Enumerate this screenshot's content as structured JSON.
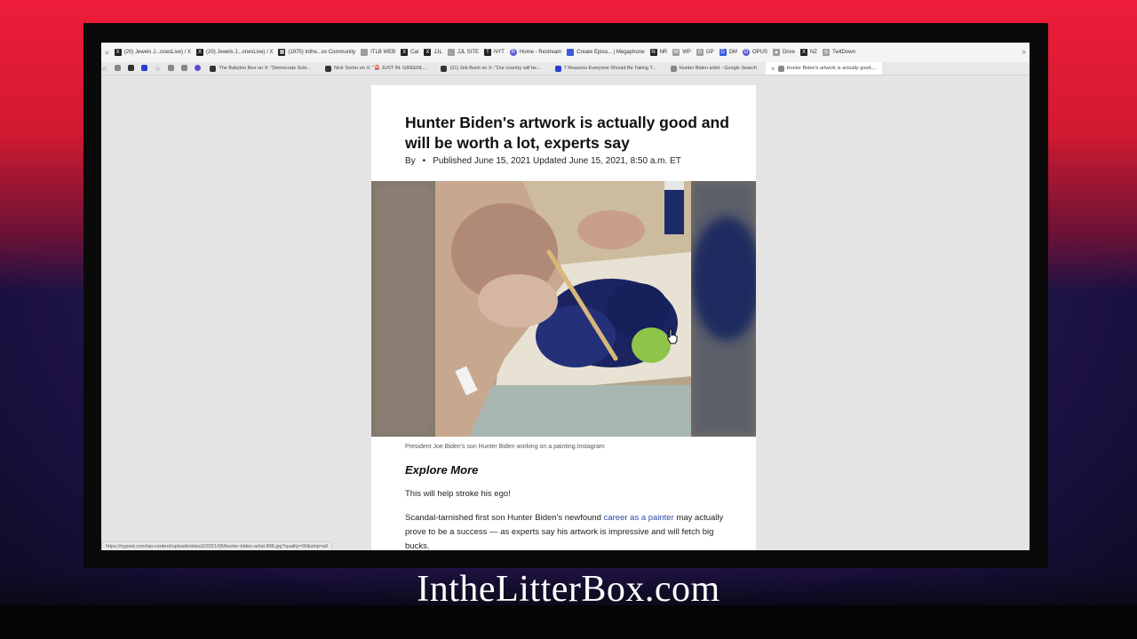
{
  "bookmarks": [
    {
      "label": "(20) Jewels J...onesLive) / X",
      "icon": "x-icon"
    },
    {
      "label": "(20) Jewels J...onesLive) / X",
      "icon": "x-icon"
    },
    {
      "label": "(1975) Inthe...ox Community",
      "icon": "grid-icon"
    },
    {
      "label": "ITLB WEB",
      "icon": "cat-icon"
    },
    {
      "label": "Cat",
      "icon": "x-icon"
    },
    {
      "label": "JJL",
      "icon": "x-icon"
    },
    {
      "label": "JJL SITE",
      "icon": "cat-icon"
    },
    {
      "label": "NYT",
      "icon": "nyt-icon"
    },
    {
      "label": "Home - Restream",
      "icon": "restream-icon"
    },
    {
      "label": "Create Episo... | Megaphone",
      "icon": "megaphone-icon"
    },
    {
      "label": "NR",
      "icon": "nr-icon"
    },
    {
      "label": "WP",
      "icon": "wp-icon"
    },
    {
      "label": "GP",
      "icon": "gp-icon"
    },
    {
      "label": "DM",
      "icon": "dm-icon"
    },
    {
      "label": "OPUS",
      "icon": "opus-icon"
    },
    {
      "label": "Drive",
      "icon": "drive-icon"
    },
    {
      "label": "NZ",
      "icon": "x-icon"
    },
    {
      "label": "TwitDown",
      "icon": "globe-icon"
    }
  ],
  "tabs": [
    {
      "label": "The Babylon Bee on X: \"Democrats Sole...",
      "active": false
    },
    {
      "label": "Nick Sortor on X: \"🚨 JUST IN: GREENL...",
      "active": false
    },
    {
      "label": "(21) Jeb Bush on X: \"Our country will be...",
      "active": false
    },
    {
      "label": "7 Reasons Everyone Should Be Taking T...",
      "active": false
    },
    {
      "label": "Hunter Biden artist - Google Search",
      "active": false
    },
    {
      "label": "Hunter Biden's artwork is actually good,...",
      "active": true
    }
  ],
  "article": {
    "headline": "Hunter Biden's artwork is actually good and will be worth a lot, experts say",
    "byline_by": "By",
    "byline_sep": "•",
    "byline_dates": "Published June 15, 2021 Updated June 15, 2021, 8:50 a.m. ET",
    "caption": "President Joe Biden's son Hunter Biden working on a painting.Instagram",
    "explore_heading": "Explore More",
    "para1": "This will help stroke his ego!",
    "para2_before": "Scandal-tarnished first son Hunter Biden's newfound ",
    "para2_link": "career as a painter",
    "para2_after": " may actually prove to be a success — as experts say his artwork is impressive and will fetch big bucks."
  },
  "status_url": "https://nypost.com/wp-content/uploads/sites/2/2021/06/hunter-biden-artist-898.jpg?quality=90&strip=all",
  "site_watermark": "IntheLitterBox.com",
  "colors": {
    "bg_red": "#ee1d3a",
    "bg_purple": "#1a1040",
    "link": "#2a4aa8"
  }
}
